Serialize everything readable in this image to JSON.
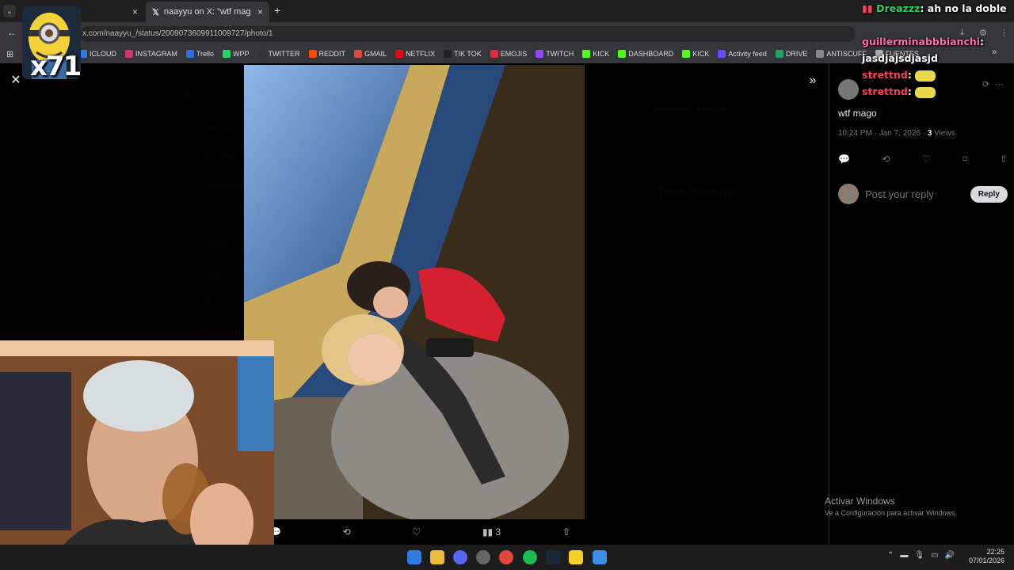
{
  "browser": {
    "tabs": [
      {
        "title": ""
      },
      {
        "title": "naayyu on X: \"wtf mago https:/"
      }
    ],
    "new_tab": "+",
    "url": "x.com/naayyu_/status/2009073609911009727/photo/1",
    "bookmarks": [
      {
        "label": "ICLOUD",
        "color": "#2f7be0"
      },
      {
        "label": "INSTAGRAM",
        "color": "#d6336c"
      },
      {
        "label": "Trello",
        "color": "#2f6fe0"
      },
      {
        "label": "WPP",
        "color": "#25d366"
      },
      {
        "label": "TWITTER",
        "color": "#333333"
      },
      {
        "label": "REDDIT",
        "color": "#ff4500"
      },
      {
        "label": "GMAIL",
        "color": "#e0463a"
      },
      {
        "label": "NETFLIX",
        "color": "#e50914"
      },
      {
        "label": "TIK TOK",
        "color": "#222222"
      },
      {
        "label": "EMOJIS",
        "color": "#e02f3a"
      },
      {
        "label": "TWITCH",
        "color": "#9146ff"
      },
      {
        "label": "KICK",
        "color": "#53fc18"
      },
      {
        "label": "DASHBOARD",
        "color": "#53fc18"
      },
      {
        "label": "KICK",
        "color": "#53fc18"
      },
      {
        "label": "Activity feed",
        "color": "#6b4bff"
      },
      {
        "label": "DRIVE",
        "color": "#1fa463"
      },
      {
        "label": "ANTISCUFF",
        "color": "#888888"
      },
      {
        "label": "FUENTES",
        "color": "#aaaaaa"
      }
    ]
  },
  "media_viewer": {
    "close_icon": "close-icon",
    "expand_icon": "double-chevron-right-icon",
    "actions": {
      "views_count": "3"
    }
  },
  "tweet": {
    "text": "wtf mago",
    "time": "10:24 PM · Jan 7, 2026 · ",
    "views": "3",
    "views_label": " Views",
    "reply_placeholder": "Post your reply",
    "reply_button": "Reply"
  },
  "chat": {
    "messages": [
      {
        "user": "Dreazzz",
        "text": "ah no la doble vara ..."
      },
      {
        "user": "guillerminabbbianchi",
        "text": "jasdjajsdjasjd"
      },
      {
        "user": "strettnd",
        "text": ""
      },
      {
        "user": "strettnd",
        "text": ""
      }
    ]
  },
  "overlay_badge": {
    "count": "x71"
  },
  "windows_watermark": {
    "title": "Activar Windows",
    "subtitle": "Ve a Configuración para activar Windows."
  },
  "system": {
    "time": "22:25",
    "date": "07/01/2026"
  }
}
